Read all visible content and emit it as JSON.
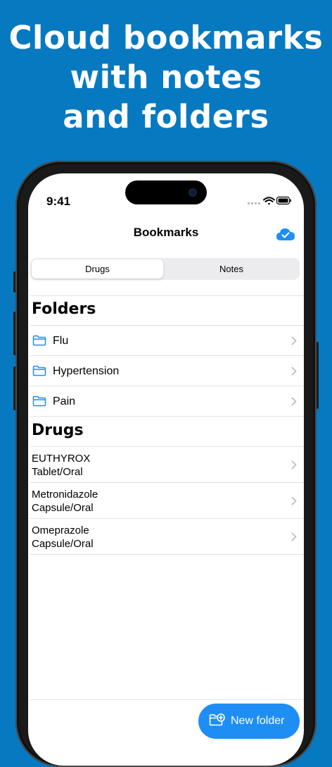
{
  "headline": {
    "line1": "Cloud bookmarks",
    "line2": "with notes",
    "line3": "and folders"
  },
  "status_bar": {
    "time": "9:41"
  },
  "nav": {
    "title": "Bookmarks",
    "sync_icon": "cloud-check-icon"
  },
  "segments": {
    "active": "Drugs",
    "inactive": "Notes"
  },
  "folders": {
    "title": "Folders",
    "items": [
      {
        "label": "Flu"
      },
      {
        "label": "Hypertension"
      },
      {
        "label": "Pain"
      }
    ]
  },
  "drugs": {
    "title": "Drugs",
    "items": [
      {
        "name": "EUTHYROX",
        "form": "Tablet/Oral"
      },
      {
        "name": "Metronidazole",
        "form": "Capsule/Oral"
      },
      {
        "name": "Omeprazole",
        "form": "Capsule/Oral"
      }
    ]
  },
  "fab": {
    "label": "New folder",
    "icon": "new-folder-icon"
  },
  "colors": {
    "background": "#0779c0",
    "accent": "#1e8ef5",
    "chevron": "#c4c4c7"
  }
}
